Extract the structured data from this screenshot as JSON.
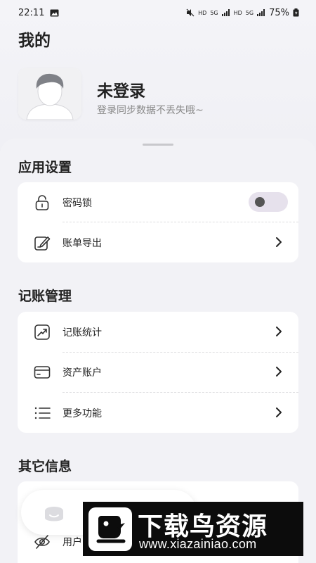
{
  "status_bar": {
    "time": "22:11",
    "net1": "HD",
    "sig1": "5G",
    "net2": "HD",
    "sig2": "5G",
    "battery": "75%"
  },
  "page": {
    "title": "我的"
  },
  "profile": {
    "name": "未登录",
    "subtitle": "登录同步数据不丢失哦~"
  },
  "sections": {
    "app_settings": {
      "title": "应用设置",
      "items": [
        {
          "label": "密码锁",
          "icon": "lock-icon",
          "control": "toggle",
          "on": false
        },
        {
          "label": "账单导出",
          "icon": "edit-note-icon",
          "control": "chevron"
        }
      ]
    },
    "bookkeeping": {
      "title": "记账管理",
      "items": [
        {
          "label": "记账统计",
          "icon": "trend-chart-icon",
          "control": "chevron"
        },
        {
          "label": "资产账户",
          "icon": "card-icon",
          "control": "chevron"
        },
        {
          "label": "更多功能",
          "icon": "list-icon",
          "control": "chevron"
        }
      ]
    },
    "other": {
      "title": "其它信息",
      "items": [
        {
          "label": "用户",
          "icon": "eye-off-icon",
          "control": "chevron"
        }
      ]
    }
  },
  "watermark": {
    "title": "下载鸟资源",
    "url": "www.xiazainiao.com"
  },
  "colors": {
    "background": "#f2f2f6",
    "card": "#ffffff",
    "toggle_track": "#e6e1ec",
    "toggle_knob": "#555555",
    "watermark_bg": "#0c0c0c"
  }
}
